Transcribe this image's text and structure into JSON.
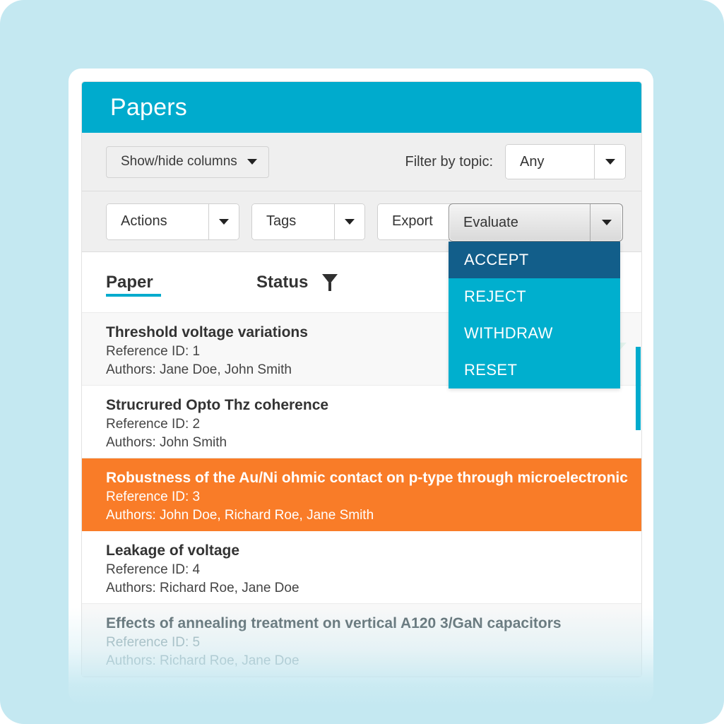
{
  "app": {
    "title": "Papers"
  },
  "toolbar_top": {
    "show_hide_columns_label": "Show/hide columns",
    "filter_label": "Filter by topic:",
    "filter_value": "Any"
  },
  "toolbar_actions": {
    "actions_label": "Actions",
    "tags_label": "Tags",
    "export_label": "Export",
    "evaluate_label": "Evaluate"
  },
  "evaluate_menu": {
    "open": true,
    "items": [
      {
        "label": "ACCEPT",
        "highlighted": true
      },
      {
        "label": "REJECT",
        "highlighted": false
      },
      {
        "label": "WITHDRAW",
        "highlighted": false
      },
      {
        "label": "RESET",
        "highlighted": false
      }
    ]
  },
  "grid": {
    "columns": [
      {
        "label": "Paper",
        "sorted": true
      },
      {
        "label": "Status",
        "filter_icon": "funnel-icon"
      }
    ],
    "rows": [
      {
        "title": "Threshold voltage variations",
        "reference": "Reference ID: 1",
        "authors": "Authors: Jane Doe, John Smith",
        "status": "",
        "state": "alt"
      },
      {
        "title": "Strucrured Opto Thz coherence",
        "reference": "Reference ID: 2",
        "authors": "Authors: John Smith",
        "status": "",
        "state": "plain"
      },
      {
        "title": "Robustness of the Au/Ni ohmic contact on p-type through microelectronic",
        "reference": "Reference ID: 3",
        "authors": "Authors: John Doe, Richard Roe, Jane Smith",
        "status": "",
        "state": "selected"
      },
      {
        "title": "Leakage of voltage",
        "reference": "Reference ID: 4",
        "authors": "Authors: Richard Roe, Jane Doe",
        "status": "",
        "state": "plain"
      },
      {
        "title": "Effects of annealing treatment on vertical A120 3/GaN capacitors",
        "reference": "Reference ID: 5",
        "authors": "Authors: Richard Roe, Jane Doe",
        "status": "",
        "state": "muted"
      }
    ]
  },
  "colors": {
    "page_background": "#c4e8f1",
    "brand_cyan": "#00abcd",
    "menu_cyan": "#00afce",
    "menu_highlight": "#125e8a",
    "selected_row_orange": "#f97c28",
    "toolbar_gray": "#efefef"
  }
}
